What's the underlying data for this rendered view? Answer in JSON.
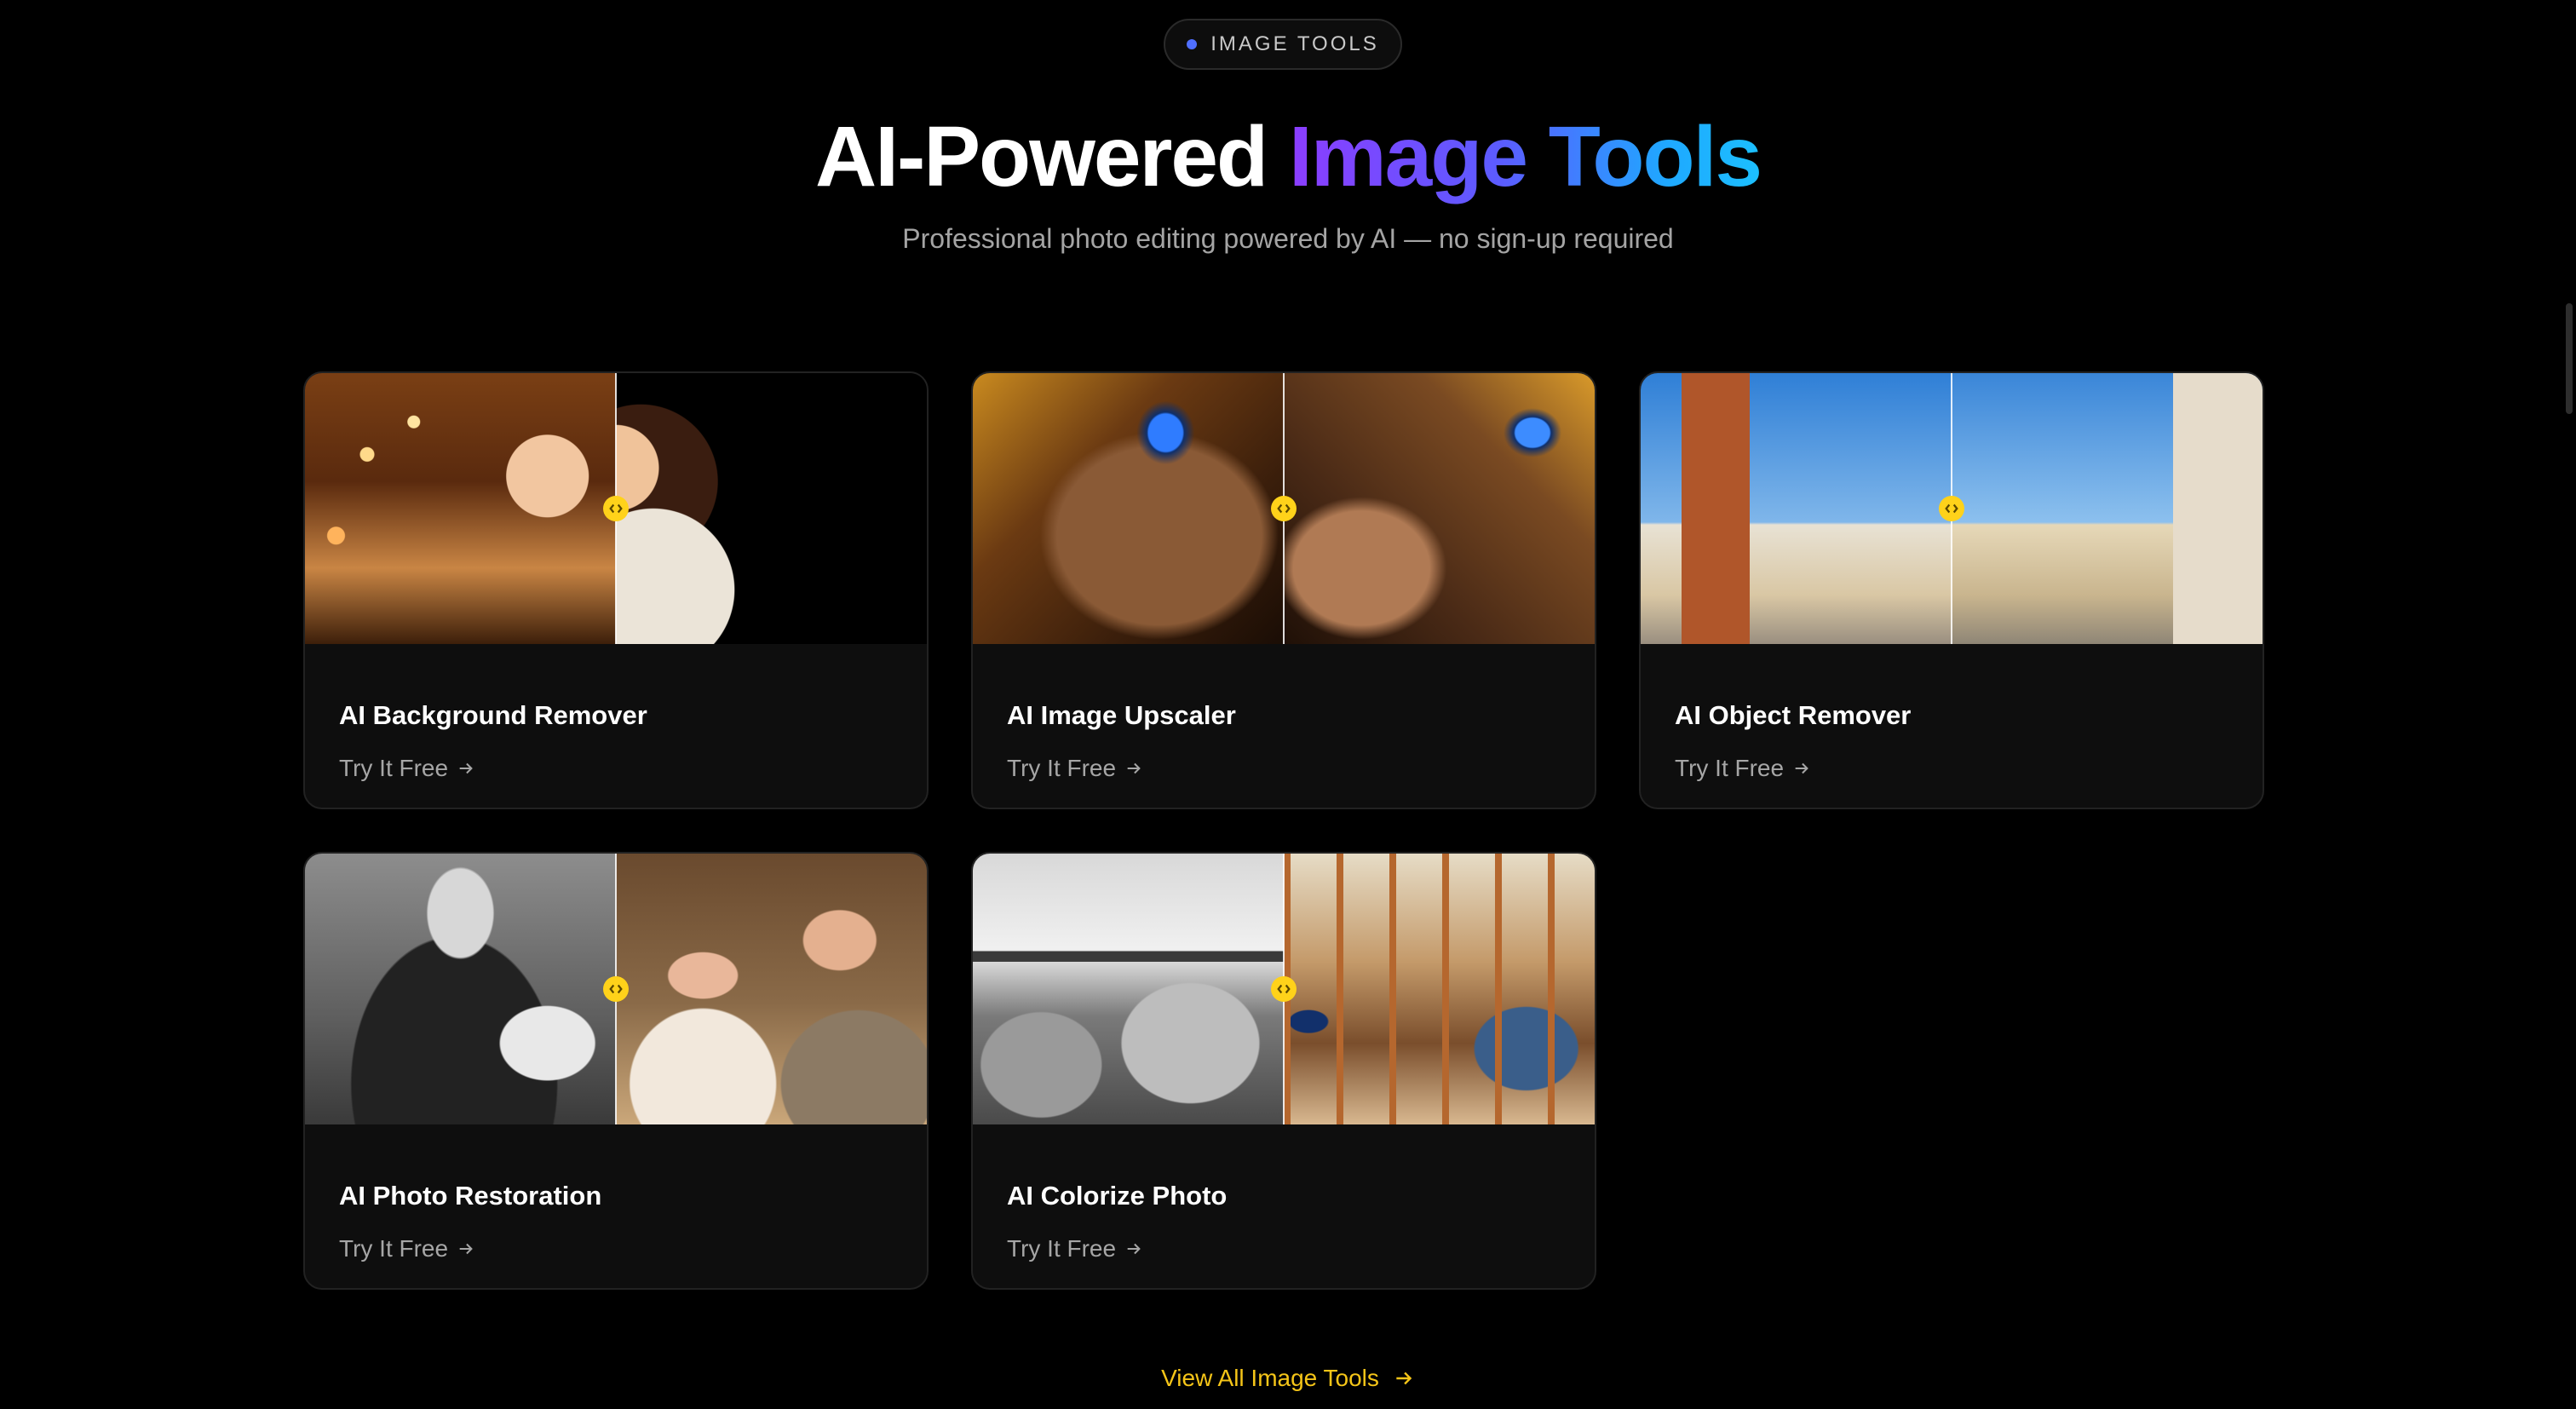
{
  "badge": {
    "text": "IMAGE TOOLS",
    "dot_color": "#4f6fff"
  },
  "heading": {
    "part1": "AI-Powered",
    "part2": "Image Tools"
  },
  "subtitle": "Professional photo editing powered by AI — no sign-up required",
  "cards": [
    {
      "title": "AI Background Remover",
      "link": "Try It Free"
    },
    {
      "title": "AI Image Upscaler",
      "link": "Try It Free"
    },
    {
      "title": "AI Object Remover",
      "link": "Try It Free"
    },
    {
      "title": "AI Photo Restoration",
      "link": "Try It Free"
    },
    {
      "title": "AI Colorize Photo",
      "link": "Try It Free"
    }
  ],
  "view_all": "View All Image Tools",
  "colors": {
    "accent": "#ffd21a",
    "link_gold": "#f5c518",
    "gradient_start": "#8b3dff",
    "gradient_end": "#1cc0ff"
  }
}
